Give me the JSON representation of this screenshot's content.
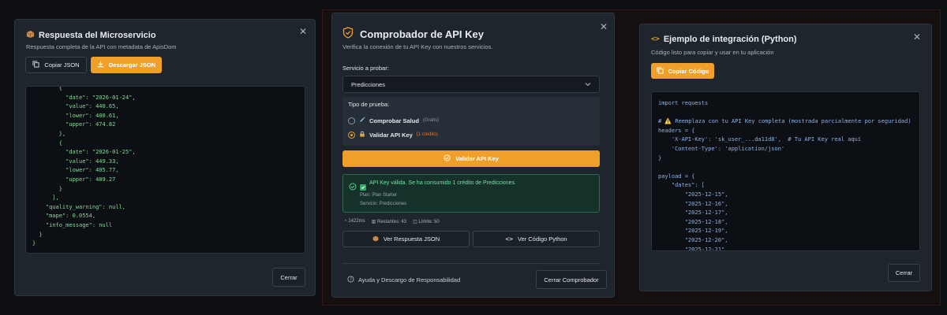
{
  "left_modal": {
    "title": "Respuesta del Microservicio",
    "subtitle": "Respuesta completa de la API con metadata de ApisDom",
    "copy_label": "Copiar JSON",
    "download_label": "Descargar JSON",
    "code": "        {\n          \"date\": \"2026-01-24\",\n          \"value\": 440.65,\n          \"lower\": 400.61,\n          \"upper\": 474.82\n        },\n        {\n          \"date\": \"2026-01-25\",\n          \"value\": 449.33,\n          \"lower\": 405.77,\n          \"upper\": 489.27\n        }\n      ],\n    \"quality_warning\": null,\n    \"mape\": 0.0554,\n    \"info_message\": null\n  }\n}",
    "close_label": "Cerrar"
  },
  "center_modal": {
    "title": "Comprobador de API Key",
    "subtitle": "Verifica la conexión de tu API Key con nuestros servicios.",
    "service_label": "Servicio a probar:",
    "service_value": "Predicciones",
    "test_type_label": "Tipo de prueba:",
    "option_health": "Comprobar Salud",
    "option_health_note": "(Gratis)",
    "option_validate": "Validar API Key",
    "option_validate_note": "(1 crédito)",
    "validate_button": "Validar API Key",
    "success_message": "API Key válida. Se ha consumido 1 crédito de Predicciones.",
    "plan_line": "Plan: Plan Starter",
    "service_line": "Servicio: Predicciones",
    "stat_time": "1422ms",
    "stat_remaining": "Restantes: 43",
    "stat_limit": "Límite: 50",
    "view_json_button": "Ver Respuesta JSON",
    "view_python_button": "Ver Código Python",
    "help_text": "Ayuda y Descargo de Responsabilidad",
    "close_button": "Cerrar Comprobador"
  },
  "right_modal": {
    "title": "Ejemplo de integración (Python)",
    "subtitle": "Código listo para copiar y usar en tu aplicación",
    "copy_label": "Copiar Código",
    "code": "import requests\n\n# ⚠️ Reemplaza con tu API Key completa (mostrada parcialmente por seguridad)\nheaders = {\n    'X-API-Key': 'sk_user_...da11d8',  # Tu API Key real aquí\n    'Content-Type': 'application/json'\n}\n\npayload = {\n    \"dates\": [\n        \"2025-12-15\",\n        \"2025-12-16\",\n        \"2025-12-17\",\n        \"2025-12-18\",\n        \"2025-12-19\",\n        \"2025-12-20\",\n        \"2025-12-21\",\n        \"2025-12-22\",",
    "close_label": "Cerrar"
  },
  "colors": {
    "accent": "#f0a02a",
    "success": "#2a6a4e",
    "json_text": "#86d897",
    "python_text": "#8fb4e6"
  }
}
